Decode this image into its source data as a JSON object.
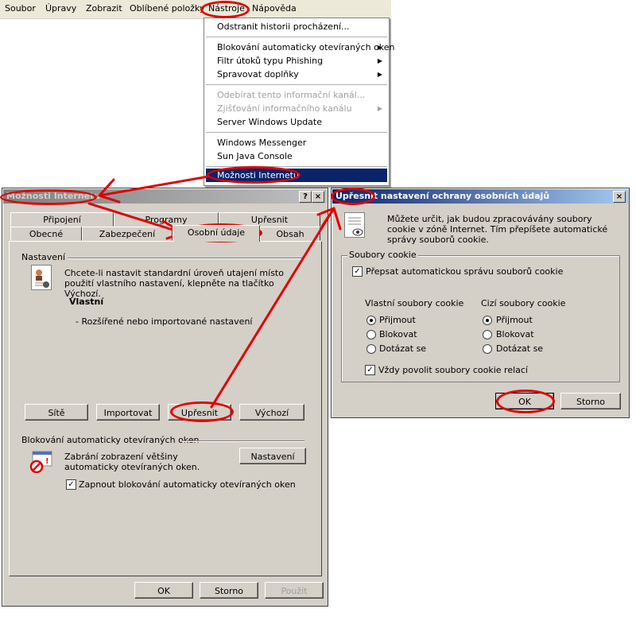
{
  "menubar": {
    "items": [
      "Soubor",
      "Úpravy",
      "Zobrazit",
      "Oblíbené položky",
      "Nástroje",
      "Nápověda"
    ]
  },
  "tools_menu": {
    "items": [
      {
        "label": "Odstranit historii procházení...",
        "disabled": false
      },
      {
        "label": "Blokování automaticky otevíraných oken",
        "submenu": true
      },
      {
        "label": "Filtr útoků typu Phishing",
        "submenu": true
      },
      {
        "label": "Spravovat doplňky",
        "submenu": true
      },
      {
        "label": "Odebírat tento informační kanál...",
        "disabled": true
      },
      {
        "label": "Zjišťování informačního kanálu",
        "disabled": true,
        "submenu": true
      },
      {
        "label": "Server Windows Update"
      },
      {
        "label": "Windows Messenger"
      },
      {
        "label": "Sun Java Console"
      },
      {
        "label": "Možnosti Internetu",
        "highlighted": true
      }
    ]
  },
  "options_dialog": {
    "title": "Možnosti Internetu",
    "help_btn": "?",
    "close_btn": "×",
    "tabs_back": [
      "Připojení",
      "Programy",
      "Upřesnit"
    ],
    "tabs_front": [
      "Obecné",
      "Zabezpečení",
      "Osobní údaje",
      "Obsah"
    ],
    "settings_group": "Nastavení",
    "settings_desc": "Chcete-li nastavit standardní úroveň utajení místo použití vlastního nastavení, klepněte na tlačítko Výchozí.",
    "level_name": "Vlastní",
    "level_desc": "- Rozšířené nebo importované nastavení",
    "buttons_mid": [
      "Sítě",
      "Importovat",
      "Upřesnit",
      "Výchozí"
    ],
    "popup_group": "Blokování automaticky otevíraných oken",
    "popup_desc": "Zabrání zobrazení většiny automaticky otevíraných oken.",
    "popup_settings_btn": "Nastavení",
    "popup_checkbox": "Zapnout blokování automaticky otevíraných oken",
    "popup_checked": true,
    "footer": {
      "ok": "OK",
      "cancel": "Storno",
      "apply": "Použít"
    }
  },
  "advanced_dialog": {
    "title": "Upřesnit nastavení ochrany osobních údajů",
    "close_btn": "×",
    "desc": "Můžete určit, jak budou zpracovávány soubory cookie v zóně Internet. Tím přepíšete automatické správy souborů cookie.",
    "cookies_group": "Soubory cookie",
    "override_label": "Přepsat automatickou správu souborů cookie",
    "override_checked": true,
    "first_party": {
      "header": "Vlastní soubory cookie",
      "options": [
        "Přijmout",
        "Blokovat",
        "Dotázat se"
      ],
      "selected": 0
    },
    "third_party": {
      "header": "Cizí soubory cookie",
      "options": [
        "Přijmout",
        "Blokovat",
        "Dotázat se"
      ],
      "selected": 0
    },
    "session_label": "Vždy povolit soubory cookie relací",
    "session_checked": true,
    "ok": "OK",
    "cancel": "Storno"
  },
  "colors": {
    "annotation": "#e00000",
    "titlebar_active": "#0a246a",
    "titlebar_inactive": "#808080",
    "face": "#d4d0c8"
  }
}
